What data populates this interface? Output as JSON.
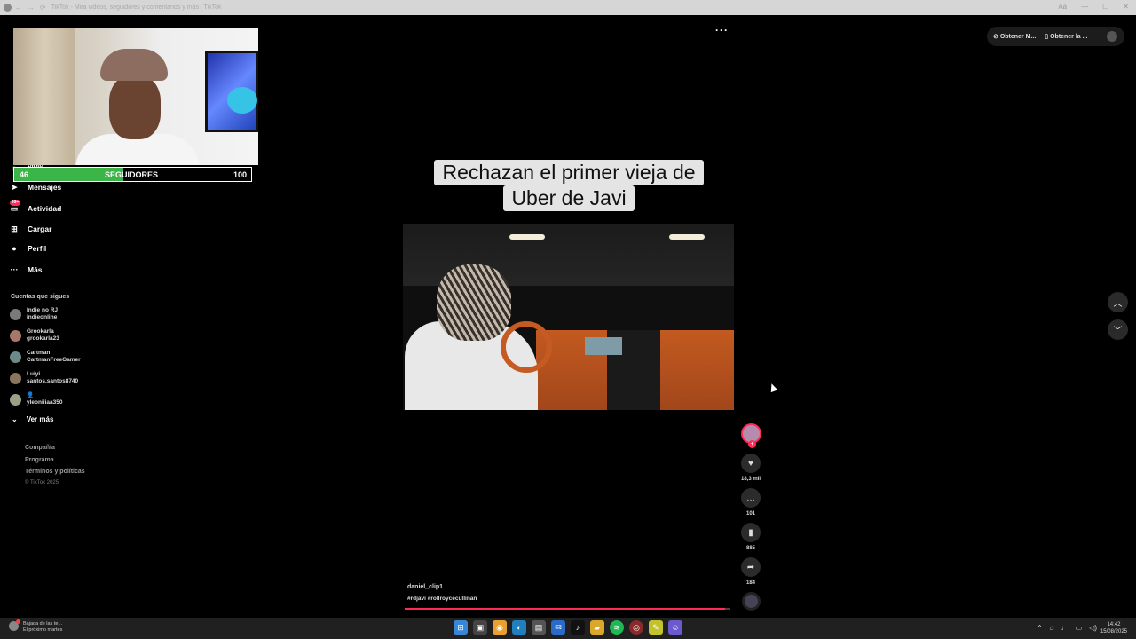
{
  "browser": {
    "title": "TikTok - Mira videos, seguidores y comentarios y más | TikTok",
    "nav": [
      "←",
      "→",
      "⟳"
    ],
    "right_controls": [
      "Aa",
      "—",
      "☐",
      "✕"
    ]
  },
  "sidebar": {
    "partial_label": "YIVIK",
    "items": [
      {
        "label": "Mensajes",
        "icon": "paper-plane-icon",
        "badge": ""
      },
      {
        "label": "Actividad",
        "icon": "inbox-icon",
        "badge": "99+"
      },
      {
        "label": "Cargar",
        "icon": "upload-icon",
        "badge": ""
      },
      {
        "label": "Perfil",
        "icon": "profile-icon",
        "badge": ""
      },
      {
        "label": "Más",
        "icon": "more-icon",
        "badge": ""
      }
    ],
    "following_label": "Cuentas que sigues",
    "following": [
      {
        "name": "Indie no RJ",
        "handle": "indieonline"
      },
      {
        "name": "Grookarla",
        "handle": "grookarla23"
      },
      {
        "name": "Cartman",
        "handle": "CartmanFreeGamer"
      },
      {
        "name": "Luiyi",
        "handle": "santos.santos8740"
      },
      {
        "name": "👤",
        "handle": "yleoniiiaa350"
      }
    ],
    "see_more": "Ver más",
    "footer_links": [
      "Compañía",
      "Programa",
      "Términos y políticas"
    ],
    "copyright": "© TikTok 2025"
  },
  "overlay": {
    "followers_min": "46",
    "followers_label": "SEGUIDORES",
    "followers_max": "100",
    "followers_progress": 0.46
  },
  "top_actions": {
    "item1": "Obtener M...",
    "item2": "Obtener la ..."
  },
  "video": {
    "more": "···",
    "caption_line1": "Rechazan el primer vieja de",
    "caption_line2": "Uber de Javi",
    "username": "daniel_clip1",
    "tags": "#rdjavi  #rollroycecullinan",
    "progress": 0.985
  },
  "rail": {
    "likes": "18,3 mil",
    "comments": "101",
    "saves": "885",
    "shares": "184"
  },
  "taskbar": {
    "weather_line1": "Bajada de las te...",
    "weather_line2": "El próximo martes",
    "time": "14:42",
    "date": "15/08/2025"
  },
  "colors": {
    "accent": "#fe2c55",
    "follower_bar": "#3cb548"
  }
}
